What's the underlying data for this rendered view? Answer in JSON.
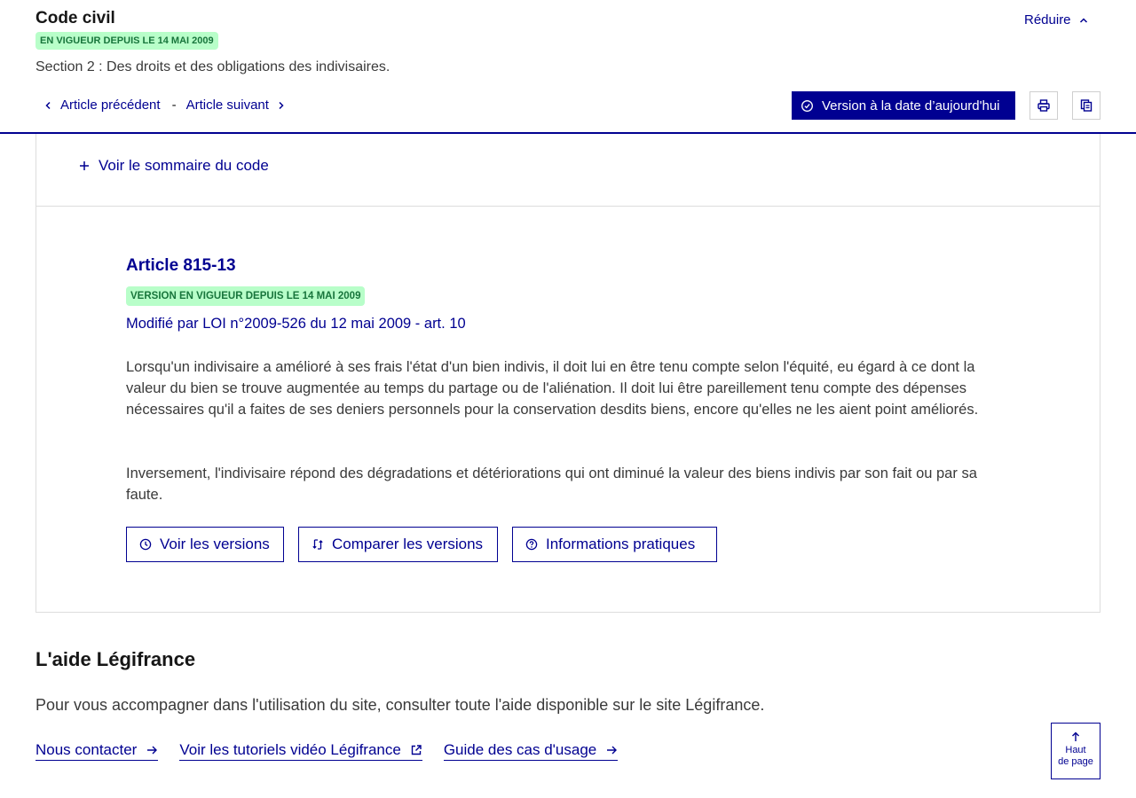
{
  "header": {
    "code_title": "Code civil",
    "status_badge": "EN VIGUEUR DEPUIS LE 14 MAI 2009",
    "section": "Section 2 : Des droits et des obligations des indivisaires.",
    "reduce_label": "Réduire",
    "prev_label": "Article précédent",
    "separator": "-",
    "next_label": "Article suivant",
    "version_today_label": "Version à la date d’aujourd'hui",
    "print_icon": "print-icon",
    "copy_icon": "copy-icon"
  },
  "summary": {
    "link_label": "Voir le sommaire du code",
    "icon": "plus-icon"
  },
  "article": {
    "title": "Article 815-13",
    "badge": "VERSION EN VIGUEUR DEPUIS LE 14 MAI 2009",
    "modified_by": "Modifié par LOI n°2009-526 du 12 mai 2009 - art. 10",
    "paragraphs": [
      "Lorsqu'un indivisaire a amélioré à ses frais l'état d'un bien indivis, il doit lui en être tenu compte selon l'équité, eu égard à ce dont la valeur du bien se trouve augmentée au temps du partage ou de l'aliénation. Il doit lui être pareillement tenu compte des dépenses nécessaires qu'il a faites de ses deniers personnels pour la conservation desdits biens, encore qu'elles ne les aient point améliorés.",
      "Inversement, l'indivisaire répond des dégradations et détériorations qui ont diminué la valeur des biens indivis par son fait ou par sa faute."
    ],
    "buttons": {
      "versions": "Voir les versions",
      "compare": "Comparer les versions",
      "info": "Informations pratiques"
    }
  },
  "aide": {
    "title": "L'aide Légifrance",
    "text": "Pour vous accompagner dans l'utilisation du site, consulter toute l'aide disponible sur le site Légifrance.",
    "links": [
      "Nous contacter",
      "Voir les tutoriels vidéo Légifrance",
      "Guide des cas d'usage"
    ]
  },
  "back_to_top": {
    "line1": "Haut",
    "line2": "de page"
  },
  "colors": {
    "primary": "#000091",
    "badge_bg": "#b8fec9",
    "badge_text": "#18753c",
    "text": "#3a3a3a"
  }
}
